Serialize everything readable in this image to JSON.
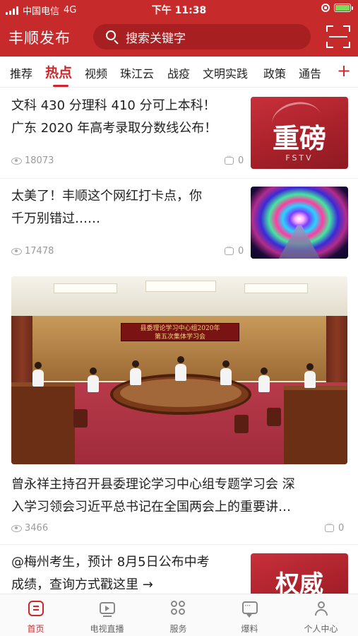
{
  "status_bar": {
    "carrier": "中国电信",
    "network": "4G",
    "time": "下午 11:38"
  },
  "header": {
    "app_title": "丰顺发布",
    "search_placeholder": "搜索关键字"
  },
  "tabs": {
    "items": [
      "推荐",
      "热点",
      "视频",
      "珠江云",
      "战疫",
      "文明实践",
      "政策",
      "通告"
    ],
    "active": "热点",
    "add_label": "+"
  },
  "feed": {
    "item1": {
      "title_line1": "文科 430 分理科 410 分可上本科！",
      "title_line2": "广东 2020 年高考录取分数线公布！",
      "views": "18073",
      "comments": "0",
      "thumb_text": "重磅",
      "thumb_sub": "FSTV"
    },
    "item2": {
      "title_line1": "太美了！丰顺这个网红打卡点，你",
      "title_line2": "千万别错过……",
      "views": "17478",
      "comments": "0"
    },
    "item3": {
      "banner_line1": "县委理论学习中心组2020年",
      "banner_line2": "第五次集体学习会",
      "title_line1": "曾永祥主持召开县委理论学习中心组专题学习会 深",
      "title_line2": "入学习领会习近平总书记在全国两会上的重要讲…",
      "views": "3466",
      "comments": "0"
    },
    "item4": {
      "title_line1": "@梅州考生，预计 8月5日公布中考",
      "title_line2": "成绩，查询方式戳这里 →",
      "thumb_text": "权威"
    }
  },
  "bottom_nav": {
    "items": [
      "首页",
      "电视直播",
      "服务",
      "爆料",
      "个人中心"
    ],
    "active": "首页"
  },
  "colors": {
    "brand_red": "#c62a2a",
    "accent_red": "#d0262a",
    "meta_gray": "#9a9a9a"
  }
}
